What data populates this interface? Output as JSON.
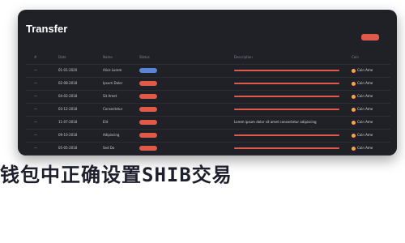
{
  "window": {
    "title": "Transfer"
  },
  "colors": {
    "panel_bg": "#1f2127",
    "accent_red": "#e05a4a",
    "coin_orange": "#f3a64a",
    "status_blue": "#5b84d6"
  },
  "table": {
    "headers": [
      "#",
      "Date",
      "Name",
      "Status",
      "Description",
      "Coin"
    ],
    "rows": [
      {
        "idx": "—",
        "date": "01-01-2020",
        "name": "Alice Lorem",
        "status": "blue",
        "desc": "",
        "coin": "Coin Ame"
      },
      {
        "idx": "—",
        "date": "02-08-2018",
        "name": "Ipsum Dolor",
        "status": "red",
        "desc": "",
        "coin": "Coin Ame"
      },
      {
        "idx": "—",
        "date": "04-02-2018",
        "name": "Sit Amet",
        "status": "red",
        "desc": "",
        "coin": "Coin Ame"
      },
      {
        "idx": "—",
        "date": "03-12-2018",
        "name": "Consectetur",
        "status": "red",
        "desc": "",
        "coin": "Coin Ame"
      },
      {
        "idx": "—",
        "date": "11-07-2018",
        "name": "Elit",
        "status": "red",
        "desc": "Lorem ipsum dolor sit amet consectetur adipiscing",
        "coin": "Coin Ame"
      },
      {
        "idx": "—",
        "date": "09-10-2018",
        "name": "Adipiscing",
        "status": "red",
        "desc": "",
        "coin": "Coin Ame"
      },
      {
        "idx": "—",
        "date": "05-05-2018",
        "name": "Sed Do",
        "status": "red",
        "desc": "",
        "coin": "Coin Ame"
      }
    ]
  },
  "banner": "钱包中正确设置SHIB交易"
}
